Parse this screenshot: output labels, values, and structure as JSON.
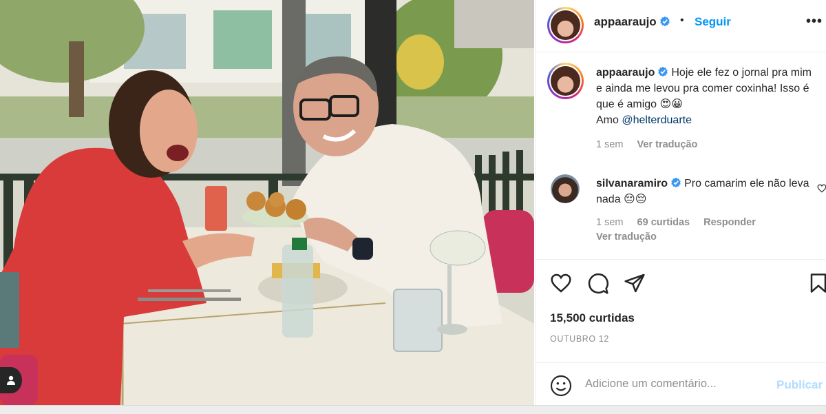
{
  "post": {
    "author": "appaaraujo",
    "follow_label": "Seguir",
    "separator": "•",
    "more_label": "•••",
    "photo_description": "Woman in red sweater and man in white shirt at a restaurant table with coxinhas"
  },
  "caption": {
    "author": "appaaraujo",
    "text": "Hoje ele fez o jornal pra mim e ainda me levou pra comer coxinha! Isso é que é amigo 😍😀",
    "text_line2": "Amo",
    "mention": "@helterduarte",
    "time": "1 sem",
    "translate": "Ver tradução"
  },
  "reply": {
    "author": "silvanaramiro",
    "text": "Pro camarim ele não leva nada 😔😔",
    "time": "1 sem",
    "likes": "69 curtidas",
    "reply_label": "Responder",
    "translate": "Ver tradução"
  },
  "stats": {
    "likes": "15,500 curtidas",
    "date": "OUTUBRO 12"
  },
  "composer": {
    "placeholder": "Adicione um comentário...",
    "publish_label": "Publicar"
  },
  "colors": {
    "accent": "#0095f6",
    "verified": "#3897f0",
    "publish_disabled": "#b3dbff"
  },
  "icons": {
    "like": "heart-icon",
    "comment": "comment-icon",
    "share": "paper-plane-icon",
    "save": "bookmark-icon",
    "emoji": "smiley-icon",
    "user_tag": "user-icon"
  }
}
